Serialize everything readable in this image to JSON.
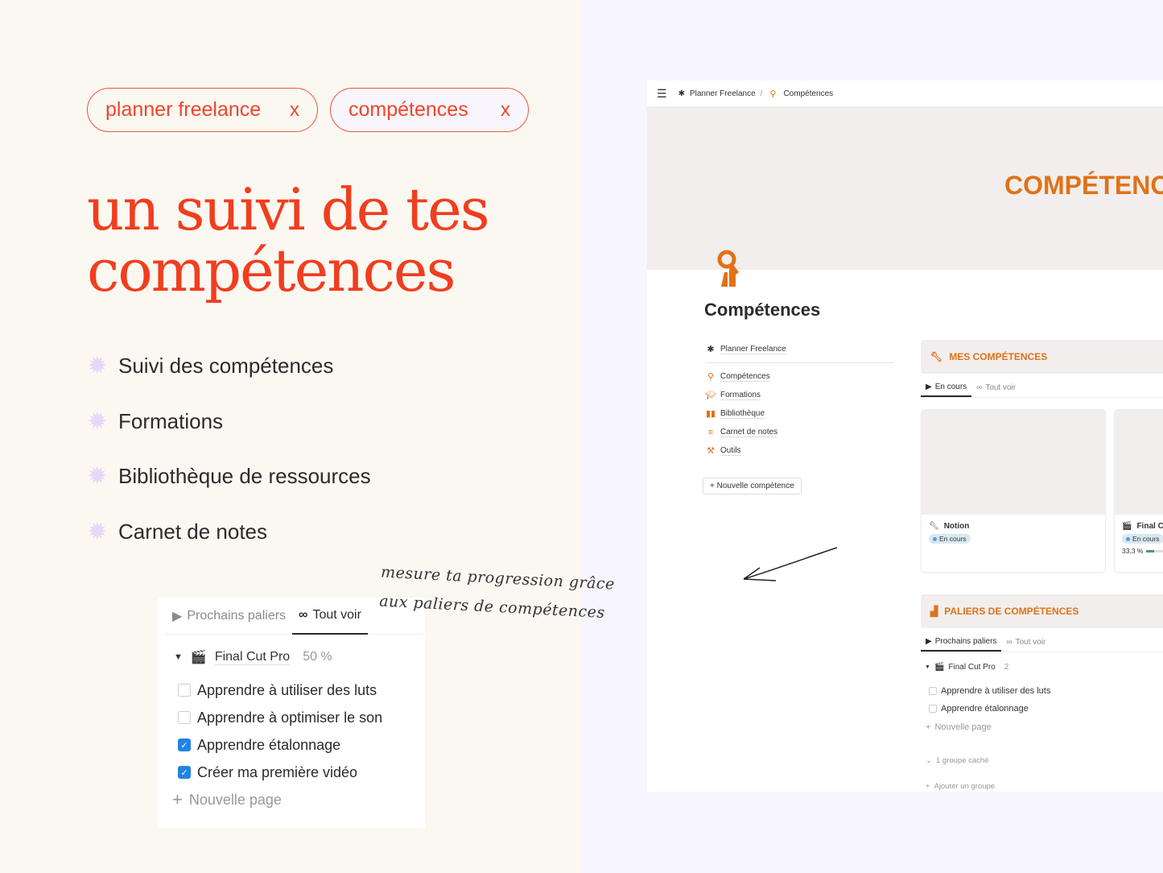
{
  "tags": [
    {
      "label": "planner freelance",
      "close": "x"
    },
    {
      "label": "compétences",
      "close": "x"
    }
  ],
  "headline": [
    "un suivi de tes",
    "compétences"
  ],
  "features": [
    "Suivi des compétences",
    "Formations",
    "Bibliothèque de ressources",
    "Carnet de notes"
  ],
  "handwritten_note": [
    "mesure ta progression grâce",
    "aux paliers de compétences"
  ],
  "preview": {
    "tabs": [
      {
        "label": "Prochains paliers",
        "icon": "play-circle-icon"
      },
      {
        "label": "Tout voir",
        "icon": "infinity-icon",
        "active": true
      }
    ],
    "group": {
      "label": "Final Cut Pro",
      "percent": "50 %"
    },
    "items": [
      {
        "label": "Apprendre à utiliser des luts",
        "checked": false
      },
      {
        "label": "Apprendre à optimiser le son",
        "checked": false
      },
      {
        "label": "Apprendre étalonnage",
        "checked": true
      },
      {
        "label": "Créer ma première vidéo",
        "checked": true
      }
    ],
    "new_page": "Nouvelle page"
  },
  "notion": {
    "breadcrumb": [
      "Planner Freelance",
      "/",
      "Compétences"
    ],
    "cover_text": "COMPÉTENC",
    "title": "Compétences",
    "parent_link": "Planner Freelance",
    "links": [
      "Compétences",
      "Formations",
      "Bibliothèque",
      "Carnet de notes",
      "Outils"
    ],
    "new_button": "Nouvelle compétence",
    "accent": "#e07218",
    "mes": {
      "title": "MES COMPÉTENCES",
      "tabs": [
        "En cours",
        "Tout voir"
      ],
      "cards": [
        {
          "name": "Notion",
          "status": "En cours"
        },
        {
          "name": "Final C",
          "status": "En cours",
          "progress": "33,3 %"
        }
      ]
    },
    "paliers": {
      "title": "PALIERS DE COMPÉTENCES",
      "tabs": [
        "Prochains paliers",
        "Tout voir"
      ],
      "group": "Final Cut Pro",
      "count": "2",
      "items": [
        "Apprendre à utiliser des luts",
        "Apprendre étalonnage"
      ],
      "new_page": "Nouvelle page",
      "hidden": "1 groupe caché",
      "add_group": "Ajouter un groupe"
    }
  }
}
